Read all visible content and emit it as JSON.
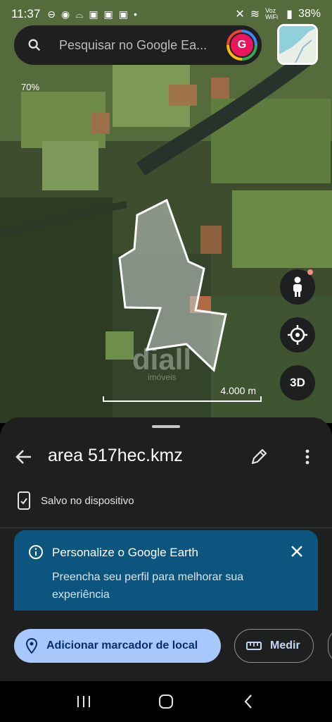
{
  "status": {
    "time": "11:37",
    "battery": "38%",
    "network": "Voz WiFi"
  },
  "search": {
    "placeholder": "Pesquisar no Google Ea...",
    "avatar_letter": "G"
  },
  "map": {
    "zoom_label": "70%",
    "scale_label": "4.000 m",
    "watermark": "diall",
    "watermark_sub": "imóveis",
    "three_d_label": "3D"
  },
  "sheet": {
    "title": "area 517hec.kmz",
    "saved_label": "Salvo no dispositivo"
  },
  "promo": {
    "title": "Personalize o Google Earth",
    "body": "Preencha seu perfil para melhorar sua experiência"
  },
  "actions": {
    "add_placemark": "Adicionar marcador de local",
    "measure": "Medir"
  },
  "colors": {
    "accent": "#a8c7fa",
    "promo_bg": "#0b557f",
    "sheet_bg": "#1e1f1f"
  }
}
